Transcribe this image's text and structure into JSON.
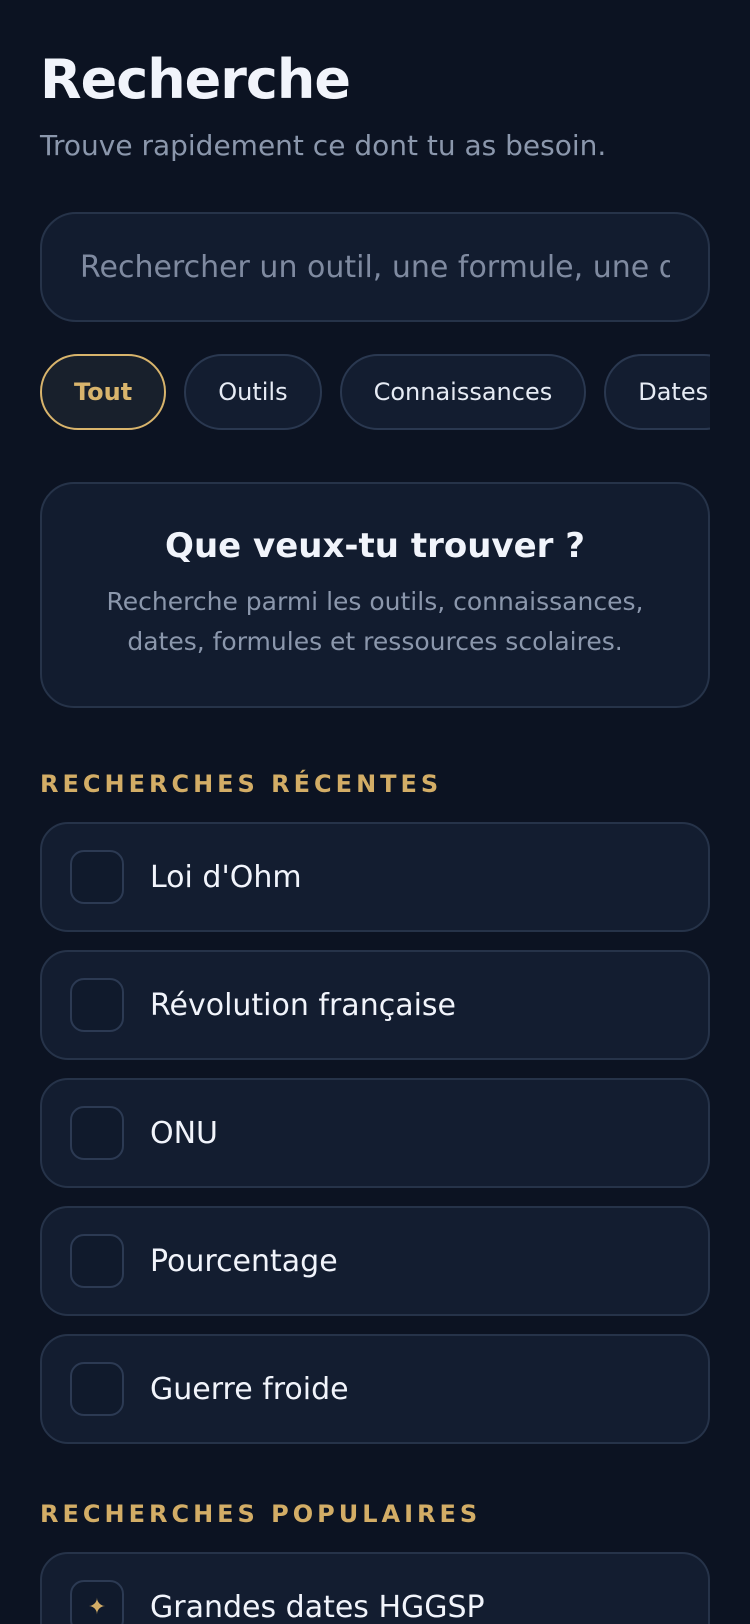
{
  "header": {
    "title": "Recherche",
    "subtitle": "Trouve rapidement ce dont tu as besoin."
  },
  "search": {
    "placeholder": "Rechercher un outil, une formule, une d",
    "value": ""
  },
  "filters": [
    {
      "label": "Tout",
      "active": true
    },
    {
      "label": "Outils",
      "active": false
    },
    {
      "label": "Connaissances",
      "active": false
    },
    {
      "label": "Dates",
      "active": false
    }
  ],
  "empty_state": {
    "title": "Que veux-tu trouver ?",
    "text": "Recherche parmi les outils, connaissances, dates, formules et ressources scolaires."
  },
  "recent": {
    "label": "RECHERCHES RÉCENTES",
    "items": [
      {
        "label": "Loi d'Ohm"
      },
      {
        "label": "Révolution française"
      },
      {
        "label": "ONU"
      },
      {
        "label": "Pourcentage"
      },
      {
        "label": "Guerre froide"
      }
    ]
  },
  "popular": {
    "label": "RECHERCHES POPULAIRES",
    "items": [
      {
        "label": "Grandes dates HGGSP"
      }
    ]
  },
  "colors": {
    "background": "#0c1322",
    "card": "#131d30",
    "accent": "#d8b46c",
    "muted_text": "#8b97ac"
  }
}
